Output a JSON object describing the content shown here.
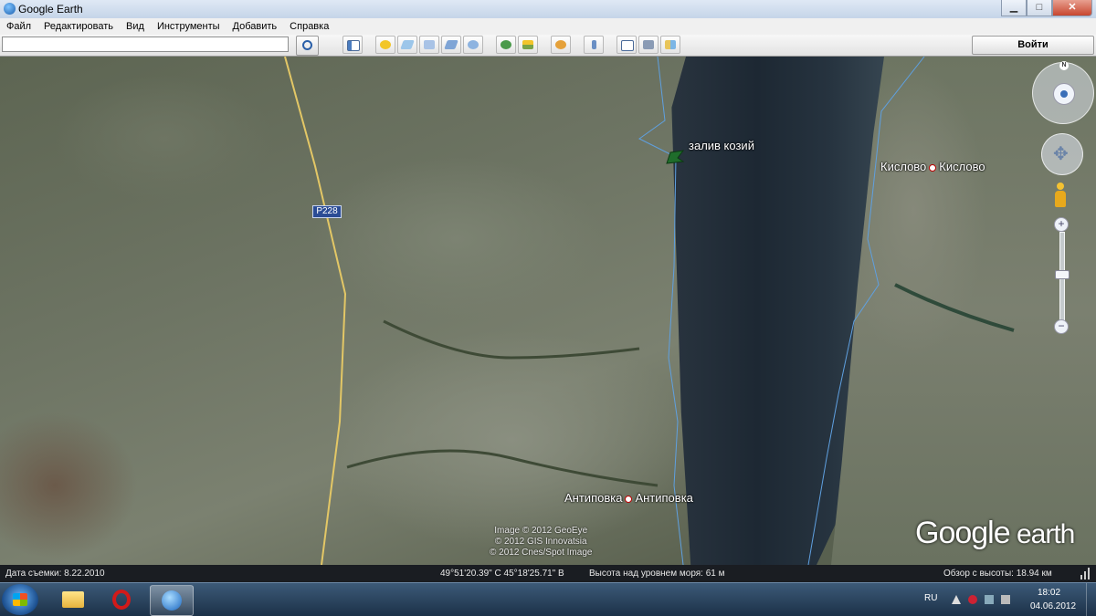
{
  "window": {
    "title": "Google Earth",
    "controls": {
      "minimize": "▁",
      "maximize": "□",
      "close": "✕"
    }
  },
  "menu": [
    "Файл",
    "Редактировать",
    "Вид",
    "Инструменты",
    "Добавить",
    "Справка"
  ],
  "toolbar": {
    "search_value": "",
    "signin_label": "Войти"
  },
  "map": {
    "places": [
      {
        "name_left": "Кислово",
        "name_right": "Кислово"
      },
      {
        "name_left": "Антиповка",
        "name_right": "Антиповка"
      }
    ],
    "placemark": "залив козий",
    "road_shield": "Р228",
    "credits": [
      "Image © 2012 GeoEye",
      "© 2012 GIS Innovatsia",
      "© 2012 Cnes/Spot Image"
    ],
    "logo": {
      "part1": "Google",
      "part2": " earth"
    },
    "compass_north": "N"
  },
  "status": {
    "imagery_date": "Дата съемки: 8.22.2010",
    "coords": "49°51'20.39\" С  45°18'25.71\" В",
    "elevation": "Высота над уровнем моря:    61 м",
    "eye_alt": "Обзор с высоты:    18.94 км"
  },
  "taskbar": {
    "lang": "RU",
    "time": "18:02",
    "date": "04.06.2012"
  },
  "colors": {
    "water": "#1d2833",
    "land": "#6d7463",
    "road": "#e3c766",
    "river_border": "#5fa0e0"
  }
}
